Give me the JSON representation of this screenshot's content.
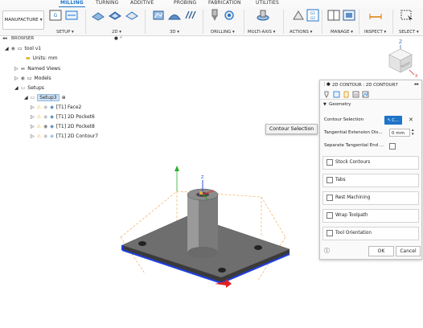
{
  "tabs": [
    "MILLING",
    "TURNING",
    "ADDITIVE",
    "PROBING",
    "FABRICATION",
    "UTILITIES"
  ],
  "workspace": "MANUFACTURE",
  "groups": {
    "setup": "SETUP",
    "twod": "2D",
    "threed": "3D",
    "drilling": "DRILLING",
    "multiaxis": "MULTI-AXIS",
    "actions": "ACTIONS",
    "manage": "MANAGE",
    "inspect": "INSPECT",
    "select": "SELECT"
  },
  "browser": {
    "title": "BROWSER",
    "root": "tool v1",
    "units": "Units: mm",
    "named_views": "Named Views",
    "models": "Models",
    "setups": "Setups",
    "setup3": "Setup3",
    "ops": [
      "[T1] Face2",
      "[T1] 2D Pocket6",
      "[T1] 2D Pocket8",
      "[T1] 2D Contour7"
    ]
  },
  "tooltip": "Contour Selection",
  "viewcube_label": "RIGHT",
  "panel": {
    "title": "2D CONTOUR : 2D CONTOUR7",
    "geometry": "Geometry",
    "contour_selection": "Contour Selection",
    "contour_btn": "C...",
    "tangential_ext": "Tangential Extension Dis...",
    "tangential_val": "0 mm",
    "separate_tangential": "Separate Tangential End ...",
    "sections": [
      "Stock Contours",
      "Tabs",
      "Rest Machining",
      "Wrap Toolpath",
      "Tool Orientation"
    ],
    "ok": "OK",
    "cancel": "Cancel"
  },
  "colors": {
    "accent": "#1e74c8",
    "warning": "#f5b400",
    "toolpath_orange": "#f2a245",
    "contour_blue": "#1f3fe0"
  }
}
